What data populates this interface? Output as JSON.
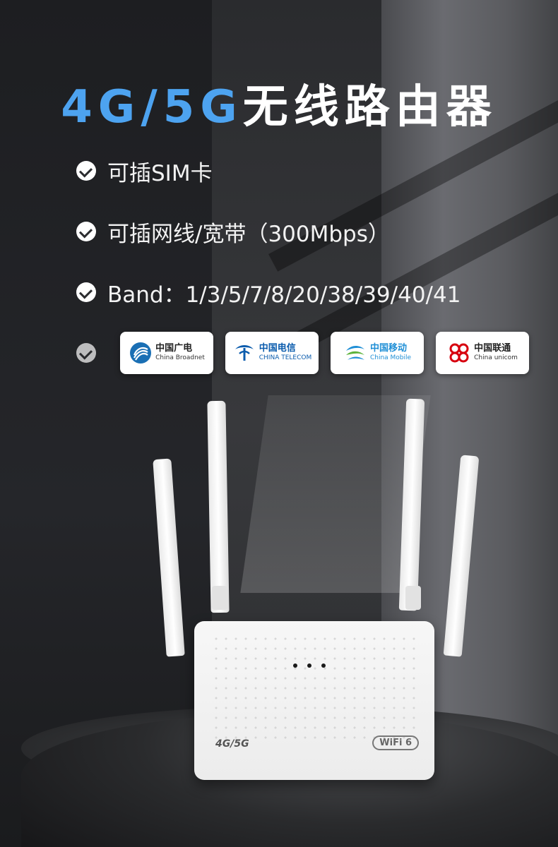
{
  "headline": {
    "part_blue": "4G/5G",
    "part_white": "无线路由器",
    "blue_color": "#4da3f0"
  },
  "features": [
    {
      "text": "可插SIM卡",
      "icon": "check-circle-icon"
    },
    {
      "text": "可插网线/宽带（300Mbps）",
      "icon": "check-circle-icon"
    },
    {
      "text": "Band：1/3/5/7/8/20/38/39/40/41",
      "icon": "check-circle-icon"
    }
  ],
  "carriers": [
    {
      "cn": "中国广电",
      "en": "China Broadnet",
      "icon": "china-broadnet-logo",
      "color": "#1a6fb4"
    },
    {
      "cn": "中国电信",
      "en": "CHINA TELECOM",
      "icon": "china-telecom-logo",
      "color": "#0b5cad"
    },
    {
      "cn": "中国移动",
      "en": "China Mobile",
      "icon": "china-mobile-logo",
      "color": "#1f8fd6"
    },
    {
      "cn": "中国联通",
      "en": "China unicom",
      "icon": "china-unicom-logo",
      "color": "#d7000f"
    }
  ],
  "router": {
    "label_4g5g": "4G/5G",
    "wifi_badge": "WiFi 6"
  }
}
